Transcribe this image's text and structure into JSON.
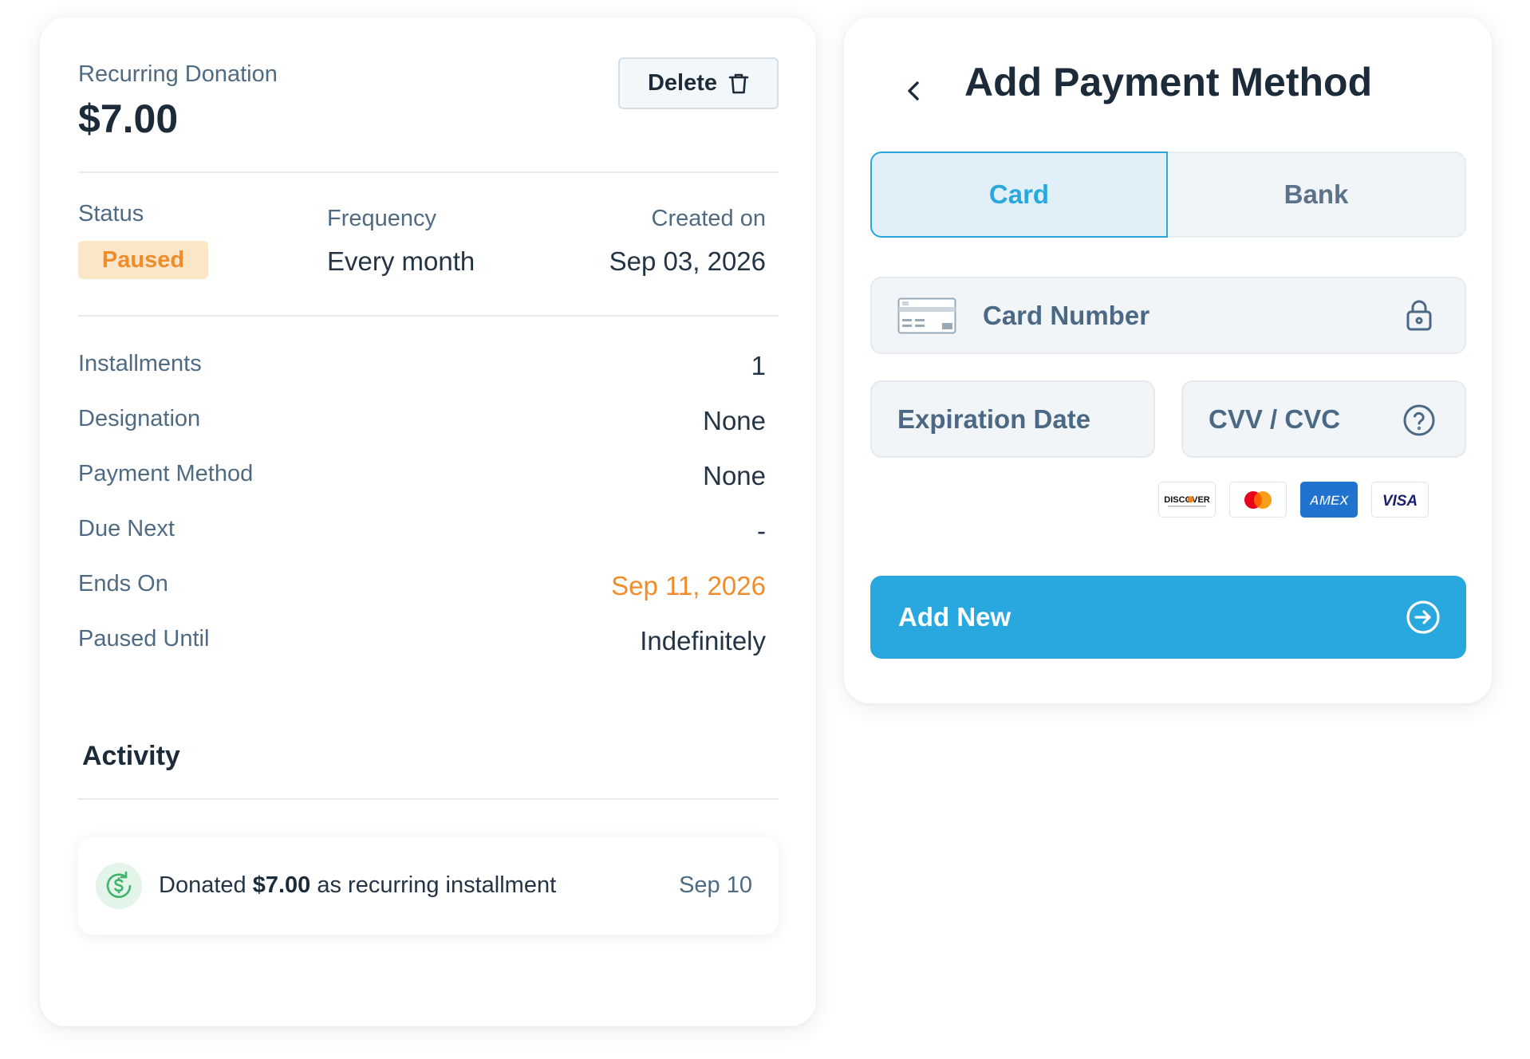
{
  "donation": {
    "type_label": "Recurring Donation",
    "amount": "$7.00",
    "delete_label": "Delete",
    "status_label": "Status",
    "status_value": "Paused",
    "frequency_label": "Frequency",
    "frequency_value": "Every month",
    "created_label": "Created on",
    "created_value": "Sep 03, 2026",
    "details": [
      {
        "label": "Installments",
        "value": "1"
      },
      {
        "label": "Designation",
        "value": "None"
      },
      {
        "label": "Payment Method",
        "value": "None"
      },
      {
        "label": "Due Next",
        "value": "-"
      },
      {
        "label": "Ends On",
        "value": "Sep 11, 2026"
      },
      {
        "label": "Paused Until",
        "value": "Indefinitely"
      }
    ],
    "activity_title": "Activity",
    "activity": {
      "prefix": "Donated",
      "amount": "$7.00",
      "suffix": "as recurring installment",
      "date": "Sep 10"
    }
  },
  "payment": {
    "title": "Add Payment Method",
    "tabs": [
      {
        "label": "Card",
        "active": true
      },
      {
        "label": "Bank",
        "active": false
      }
    ],
    "card_number_placeholder": "Card Number",
    "expiration_placeholder": "Expiration Date",
    "cvv_placeholder": "CVV / CVC",
    "card_brands": [
      "DISCOVER",
      "Mastercard",
      "AMEX",
      "VISA"
    ],
    "add_button": "Add New"
  },
  "colors": {
    "accent": "#29a8e0",
    "status_paused_bg": "#fce6c8",
    "status_paused_text": "#f08c2a",
    "ends_on_text": "#f08c2a",
    "activity_icon_green": "#3fb36b"
  },
  "icons": [
    "trash-icon",
    "chevron-left-icon",
    "credit-card-icon",
    "lock-icon",
    "help-circle-icon",
    "arrow-right-circle-icon",
    "recurring-dollar-icon"
  ]
}
